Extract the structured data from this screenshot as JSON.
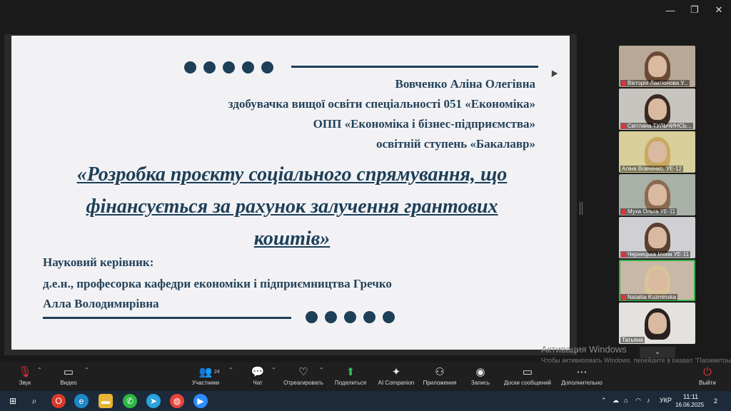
{
  "window": {
    "minimize": "—",
    "restore": "❐",
    "close": "✕"
  },
  "slide": {
    "name": "Вовченко Аліна Олегівна",
    "line2": "здобувачка вищої освіти спеціальності 051 «Економіка»",
    "line3": "ОПП «Економіка і бізнес-підприємства»",
    "line4": "освітній ступень «Бакалавр»",
    "topic_line1": "«Розробка проєкту соціального спрямування, що",
    "topic_line2": "фінансується за рахунок залучення грантових",
    "topic_line3": "коштів»",
    "supervisor_label": "Науковий керівник:",
    "supervisor_line1": "д.е.н., професорка кафедри економіки і підприємництва Гречко",
    "supervisor_line2": "Алла Володимирівна"
  },
  "participants": [
    {
      "name": "Вікторія Лактіонова У...",
      "bg": "#b8a898",
      "hair": "#6b4a35",
      "muted": true
    },
    {
      "name": "Світлана ТУЛЬЧИНСЬ...",
      "bg": "#c8c4c0",
      "hair": "#3a2a22",
      "muted": true
    },
    {
      "name": "Аліна Вовченко, УЕ-12",
      "bg": "#d8cf9a",
      "hair": "#c9a860",
      "muted": false
    },
    {
      "name": "Муха Ольга УЕ-11",
      "bg": "#a8b0a8",
      "hair": "#8a6a50",
      "muted": true
    },
    {
      "name": "Чернецька Ілона УЕ-11",
      "bg": "#d0d0d4",
      "hair": "#5a4030",
      "muted": true
    },
    {
      "name": "Nataliia Kuzminska",
      "bg": "#c8b8a8",
      "hair": "#d9c49a",
      "muted": true
    },
    {
      "name": "Татьяна",
      "bg": "#e4e2df",
      "hair": "#2a2020",
      "muted": false
    }
  ],
  "gallery_more": "⌄",
  "watermark": {
    "title": "Активация Windows",
    "subtitle": "Чтобы активировать Windows, перейдите в раздел \"Параметры\"."
  },
  "toolbar": {
    "audio": "Звук",
    "video": "Видео",
    "participants": "Участники",
    "participants_count": "24",
    "chat": "Чат",
    "react": "Отреагировать",
    "share": "Поделиться",
    "ai": "AI Companion",
    "apps": "Приложения",
    "record": "Запись",
    "whiteboards": "Доски сообщений",
    "more": "Дополнительно",
    "leave": "Выйти"
  },
  "taskbar": {
    "time": "11:11",
    "date": "16.06.2025",
    "lang": "УКР",
    "notifications": "2"
  }
}
